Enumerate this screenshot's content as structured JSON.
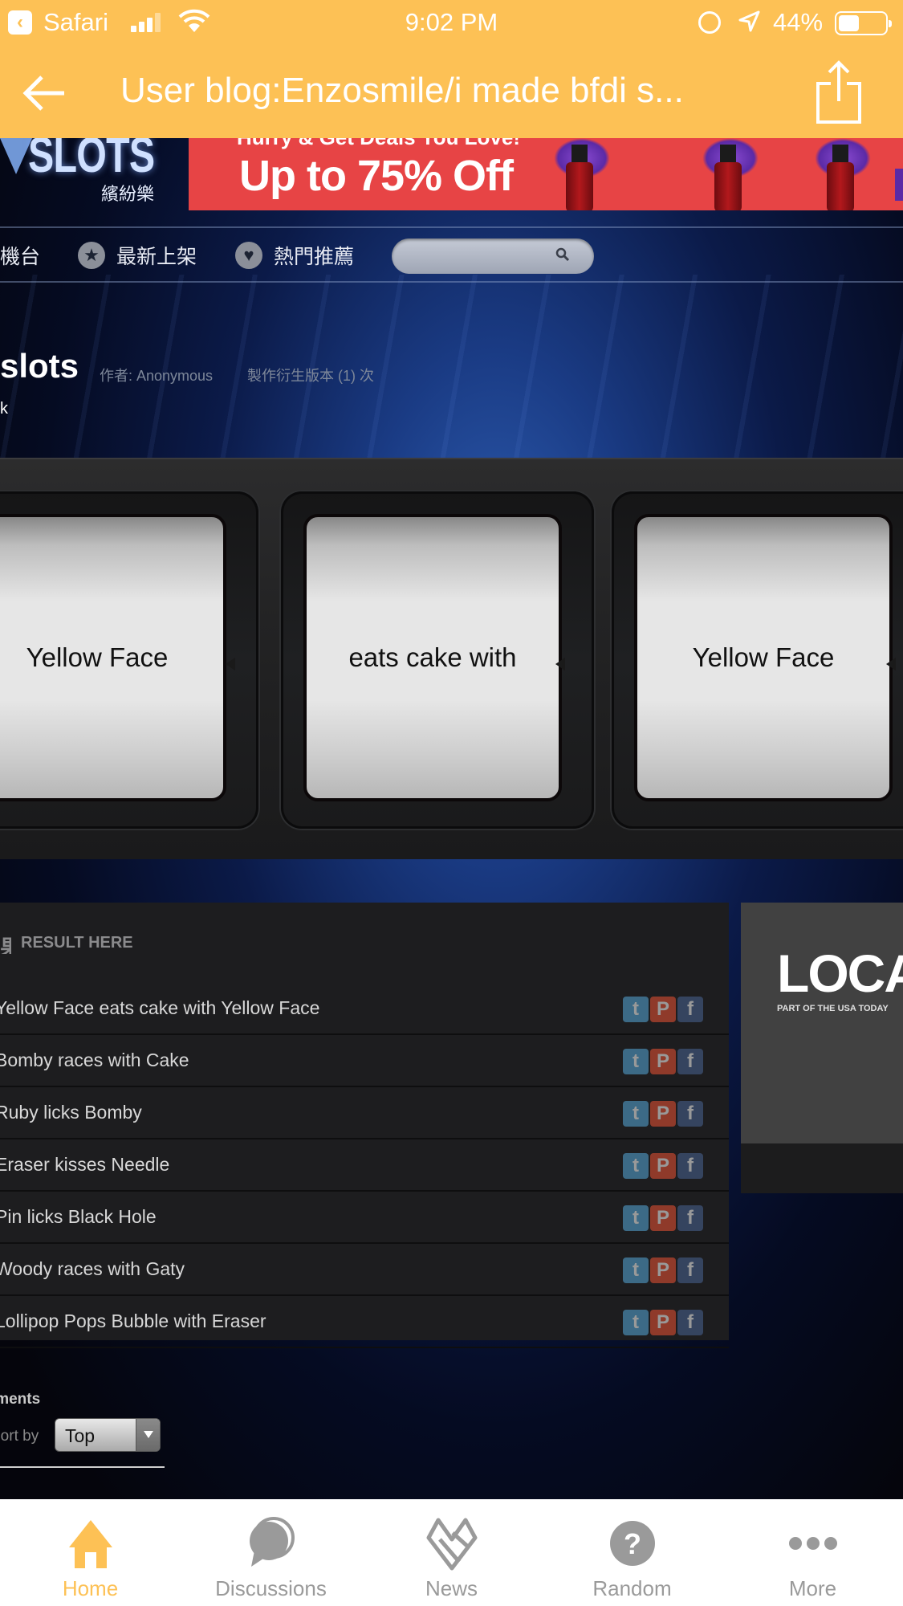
{
  "status_bar": {
    "back_app": "Safari",
    "time": "9:02 PM",
    "battery_percent": "44%",
    "battery_level": 0.44
  },
  "header": {
    "title": "User blog:Enzosmile/i made bfdi s...",
    "back_icon": "arrow-left-icon",
    "share_icon": "share-icon"
  },
  "site": {
    "logo_word": "SLOTS",
    "logo_cn": "繽紛樂",
    "ad_top_text": "Hurry & Get Deals You Love!",
    "ad_headline": "Up to 75% Off",
    "nav": [
      {
        "label": "機台",
        "icon": ""
      },
      {
        "label": "最新上架",
        "icon": "star-icon"
      },
      {
        "label": "熱門推薦",
        "icon": "heart-icon"
      }
    ],
    "search_placeholder": ""
  },
  "slot": {
    "title": "slots",
    "author": "作者: Anonymous",
    "derivatives": "製作衍生版本 (1) 次",
    "subtitle": "k",
    "reels": [
      "Yellow Face",
      "eats cake with",
      "Yellow Face"
    ]
  },
  "results": {
    "header": "RESULT HERE",
    "header_glyph": "果",
    "rows": [
      "Yellow Face eats cake with Yellow Face",
      "Bomby races with Cake",
      "Ruby licks Bomby",
      "Eraser kisses Needle",
      "Pin licks Black Hole",
      "Woody races with Gaty",
      "Lollipop Pops Bubble with Eraser"
    ],
    "share_buttons": [
      "t",
      "P",
      "f"
    ]
  },
  "side_ad": {
    "brand": "LOCA",
    "tagline": "PART OF THE USA TODAY"
  },
  "comments": {
    "label": "Comments",
    "sort_label": "Sort by",
    "sort_value": "Top"
  },
  "tabbar": {
    "items": [
      {
        "label": "Home",
        "icon": "home-icon",
        "active": true
      },
      {
        "label": "Discussions",
        "icon": "discussions-icon",
        "active": false
      },
      {
        "label": "News",
        "icon": "news-icon",
        "active": false
      },
      {
        "label": "Random",
        "icon": "random-icon",
        "active": false
      },
      {
        "label": "More",
        "icon": "more-icon",
        "active": false
      }
    ]
  },
  "colors": {
    "accent": "#fdc155",
    "ad_red": "#e74445",
    "tab_inactive": "#9a9a9a"
  }
}
